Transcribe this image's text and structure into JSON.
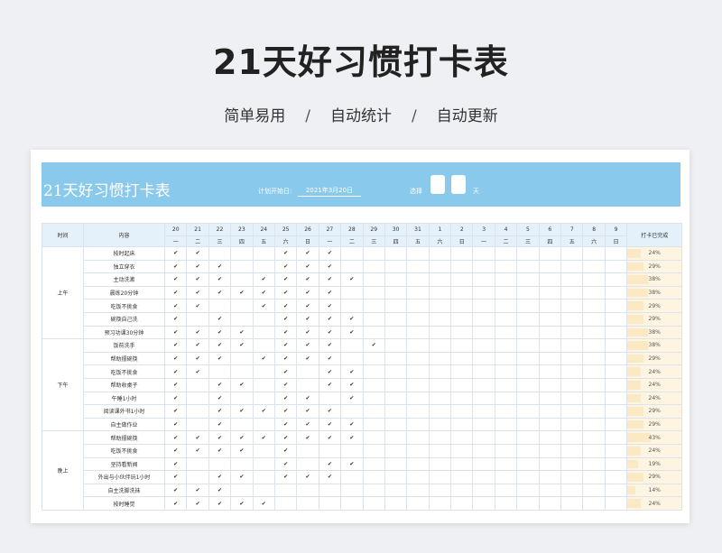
{
  "header": {
    "title": "21天好习惯打卡表",
    "tags": [
      "简单易用",
      "自动统计",
      "自动更新"
    ],
    "separator": "/"
  },
  "sheet": {
    "title": "21天好习惯打卡表",
    "start_label": "计划开始日:",
    "start_date": "2021年3月20日",
    "month_label": "选择",
    "day_unit": "天",
    "col_time": "时间",
    "col_content": "内容",
    "col_done": "打卡已完成",
    "dates": [
      "20",
      "21",
      "22",
      "23",
      "24",
      "25",
      "26",
      "27",
      "28",
      "29",
      "30",
      "31",
      "1",
      "2",
      "3",
      "4",
      "5",
      "6",
      "7",
      "8",
      "9"
    ],
    "weekdays": [
      "一",
      "二",
      "三",
      "四",
      "五",
      "六",
      "日",
      "一",
      "二",
      "三",
      "四",
      "五",
      "六",
      "日",
      "一",
      "二",
      "三",
      "四",
      "五",
      "六",
      "日"
    ],
    "check_symbol": "✔",
    "groups": [
      {
        "period": "上午",
        "rows": [
          {
            "task": "按时起床",
            "checks": [
              1,
              1,
              0,
              0,
              0,
              1,
              1,
              1,
              0,
              0,
              0,
              0,
              0,
              0,
              0,
              0,
              0,
              0,
              0,
              0,
              0
            ],
            "percent": "24%",
            "ratio": 0.24
          },
          {
            "task": "独立穿衣",
            "checks": [
              1,
              1,
              1,
              0,
              0,
              1,
              1,
              1,
              0,
              0,
              0,
              0,
              0,
              0,
              0,
              0,
              0,
              0,
              0,
              0,
              0
            ],
            "percent": "29%",
            "ratio": 0.29
          },
          {
            "task": "主动洗漱",
            "checks": [
              1,
              1,
              1,
              0,
              1,
              1,
              1,
              1,
              1,
              0,
              0,
              0,
              0,
              0,
              0,
              0,
              0,
              0,
              0,
              0,
              0
            ],
            "percent": "38%",
            "ratio": 0.38
          },
          {
            "task": "晨练20分钟",
            "checks": [
              1,
              1,
              1,
              1,
              1,
              1,
              1,
              1,
              0,
              0,
              0,
              0,
              0,
              0,
              0,
              0,
              0,
              0,
              0,
              0,
              0
            ],
            "percent": "38%",
            "ratio": 0.38
          },
          {
            "task": "吃饭不挑食",
            "checks": [
              1,
              1,
              0,
              0,
              1,
              1,
              1,
              1,
              0,
              0,
              0,
              0,
              0,
              0,
              0,
              0,
              0,
              0,
              0,
              0,
              0
            ],
            "percent": "29%",
            "ratio": 0.29
          },
          {
            "task": "碗筷自己洗",
            "checks": [
              1,
              0,
              1,
              0,
              0,
              1,
              1,
              1,
              1,
              0,
              0,
              0,
              0,
              0,
              0,
              0,
              0,
              0,
              0,
              0,
              0
            ],
            "percent": "29%",
            "ratio": 0.29
          },
          {
            "task": "预习功课30分钟",
            "checks": [
              1,
              1,
              1,
              1,
              0,
              1,
              1,
              1,
              1,
              0,
              0,
              0,
              0,
              0,
              0,
              0,
              0,
              0,
              0,
              0,
              0
            ],
            "percent": "38%",
            "ratio": 0.38
          }
        ]
      },
      {
        "period": "下午",
        "rows": [
          {
            "task": "饭前洗手",
            "checks": [
              1,
              1,
              1,
              1,
              0,
              1,
              1,
              1,
              0,
              1,
              0,
              0,
              0,
              0,
              0,
              0,
              0,
              0,
              0,
              0,
              0
            ],
            "percent": "38%",
            "ratio": 0.38
          },
          {
            "task": "帮助摆碗筷",
            "checks": [
              1,
              1,
              1,
              0,
              1,
              1,
              1,
              1,
              0,
              0,
              0,
              0,
              0,
              0,
              0,
              0,
              0,
              0,
              0,
              0,
              0
            ],
            "percent": "29%",
            "ratio": 0.29
          },
          {
            "task": "吃饭不挑食",
            "checks": [
              1,
              1,
              0,
              0,
              0,
              1,
              0,
              1,
              1,
              0,
              0,
              0,
              0,
              0,
              0,
              0,
              0,
              0,
              0,
              0,
              0
            ],
            "percent": "24%",
            "ratio": 0.24
          },
          {
            "task": "帮助收桌子",
            "checks": [
              1,
              0,
              1,
              1,
              0,
              1,
              0,
              1,
              1,
              0,
              0,
              0,
              0,
              0,
              0,
              0,
              0,
              0,
              0,
              0,
              0
            ],
            "percent": "24%",
            "ratio": 0.24
          },
          {
            "task": "午睡1小时",
            "checks": [
              1,
              0,
              1,
              0,
              0,
              1,
              1,
              0,
              1,
              0,
              0,
              0,
              0,
              0,
              0,
              0,
              0,
              0,
              0,
              0,
              0
            ],
            "percent": "24%",
            "ratio": 0.24
          },
          {
            "task": "阅读课外书1小时",
            "checks": [
              1,
              0,
              1,
              1,
              1,
              1,
              1,
              1,
              0,
              0,
              0,
              0,
              0,
              0,
              0,
              0,
              0,
              0,
              0,
              0,
              0
            ],
            "percent": "29%",
            "ratio": 0.29
          },
          {
            "task": "自主做作业",
            "checks": [
              1,
              0,
              1,
              0,
              0,
              1,
              1,
              1,
              1,
              0,
              0,
              0,
              0,
              0,
              0,
              0,
              0,
              0,
              0,
              0,
              0
            ],
            "percent": "29%",
            "ratio": 0.29
          }
        ]
      },
      {
        "period": "晚上",
        "rows": [
          {
            "task": "帮助摆碗筷",
            "checks": [
              1,
              1,
              1,
              1,
              1,
              1,
              1,
              1,
              1,
              0,
              0,
              0,
              0,
              0,
              0,
              0,
              0,
              0,
              0,
              0,
              0
            ],
            "percent": "43%",
            "ratio": 0.43
          },
          {
            "task": "吃饭不挑食",
            "checks": [
              1,
              1,
              1,
              1,
              0,
              1,
              0,
              0,
              0,
              0,
              0,
              0,
              0,
              0,
              0,
              0,
              0,
              0,
              0,
              0,
              0
            ],
            "percent": "24%",
            "ratio": 0.24
          },
          {
            "task": "坚持看新闻",
            "checks": [
              1,
              0,
              0,
              0,
              0,
              1,
              0,
              1,
              1,
              0,
              0,
              0,
              0,
              0,
              0,
              0,
              0,
              0,
              0,
              0,
              0
            ],
            "percent": "19%",
            "ratio": 0.19
          },
          {
            "task": "外出与小伙伴玩1小时",
            "checks": [
              1,
              0,
              1,
              1,
              0,
              1,
              1,
              1,
              0,
              0,
              0,
              0,
              0,
              0,
              0,
              0,
              0,
              0,
              0,
              0,
              0
            ],
            "percent": "29%",
            "ratio": 0.29
          },
          {
            "task": "自主洗脚洗袜",
            "checks": [
              1,
              1,
              1,
              0,
              0,
              0,
              0,
              0,
              0,
              0,
              0,
              0,
              0,
              0,
              0,
              0,
              0,
              0,
              0,
              0,
              0
            ],
            "percent": "14%",
            "ratio": 0.14
          },
          {
            "task": "按时睡觉",
            "checks": [
              1,
              1,
              1,
              1,
              1,
              0,
              0,
              0,
              0,
              0,
              0,
              0,
              0,
              0,
              0,
              0,
              0,
              0,
              0,
              0,
              0
            ],
            "percent": "24%",
            "ratio": 0.24
          }
        ]
      }
    ]
  }
}
